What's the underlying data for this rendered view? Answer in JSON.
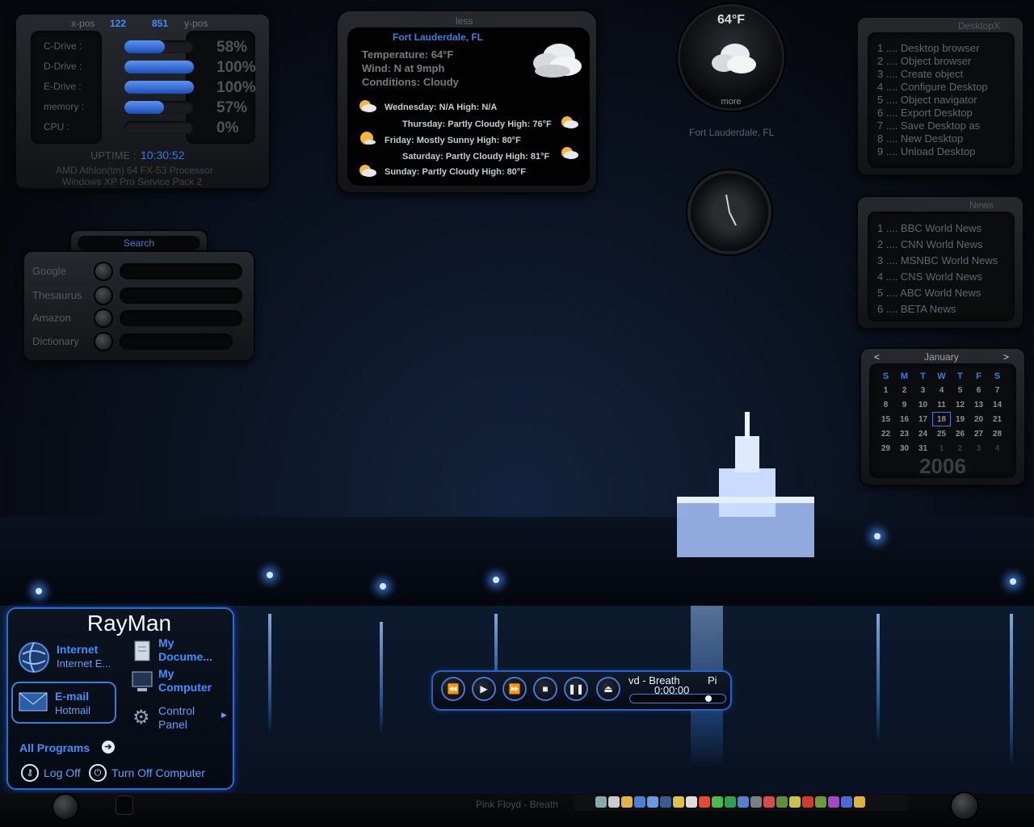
{
  "sysmon": {
    "xpos_label": "x-pos",
    "xpos_value": "122",
    "ypos_value": "851",
    "ypos_label": "y-pos",
    "drives": [
      {
        "label": "C-Drive :",
        "percent": "58%",
        "fill": 0.58
      },
      {
        "label": "D-Drive :",
        "percent": "100%",
        "fill": 1.0
      },
      {
        "label": "E-Drive :",
        "percent": "100%",
        "fill": 1.0
      },
      {
        "label": "memory :",
        "percent": "57%",
        "fill": 0.57
      },
      {
        "label": "CPU :",
        "percent": "0%",
        "fill": 0.0
      }
    ],
    "uptime_label": "UPTIME :",
    "uptime_value": "10:30:52",
    "processor": "AMD Athlon(tm) 64 FX-53 Processor",
    "os": "Windows XP Pro Service Pack 2"
  },
  "weather": {
    "less_label": "less",
    "city": "Fort Lauderdale, FL",
    "temperature": "Temperature: 64°F",
    "wind": "Wind: N at 9mph",
    "conditions": "Conditions: Cloudy",
    "forecast": [
      "Wednesday: N/A High: N/A",
      "Thursday: Partly Cloudy High: 76°F",
      "Friday: Mostly Sunny High: 80°F",
      "Saturday: Partly Cloudy High: 81°F",
      "Sunday: Partly Cloudy High: 80°F"
    ]
  },
  "weather_orb": {
    "temp": "64°F",
    "more_label": "more",
    "city": "Fort Lauderdale, FL"
  },
  "desktopx": {
    "title": "DesktopX",
    "items": [
      "1 .... Desktop browser",
      "2 .... Object browser",
      "3 .... Create object",
      "4 .... Configure Desktop",
      "5 .... Object navigator",
      "6 .... Export Desktop",
      "7 .... Save Desktop as",
      "8 .... New Desktop",
      "9 .... Unload Desktop"
    ]
  },
  "news": {
    "title": "News",
    "items": [
      "1 .... BBC World News",
      "2 .... CNN World News",
      "3 .... MSNBC World News",
      "4 .... CNS World News",
      "5 .... ABC World News",
      "6 .... BETA  News"
    ]
  },
  "search": {
    "title": "Search",
    "engines": [
      "Google",
      "Thesaurus",
      "Amazon",
      "Dictionary"
    ]
  },
  "calendar": {
    "month": "January",
    "prev": "<",
    "next": ">",
    "year": "2006",
    "weekdays": [
      "S",
      "M",
      "T",
      "W",
      "T",
      "F",
      "S"
    ],
    "weeks": [
      [
        "1",
        "2",
        "3",
        "4",
        "5",
        "6",
        "7"
      ],
      [
        "8",
        "9",
        "10",
        "11",
        "12",
        "13",
        "14"
      ],
      [
        "15",
        "16",
        "17",
        "18",
        "19",
        "20",
        "21"
      ],
      [
        "22",
        "23",
        "24",
        "25",
        "26",
        "27",
        "28"
      ],
      [
        "29",
        "30",
        "31",
        "1",
        "2",
        "3",
        "4"
      ]
    ],
    "today": "18"
  },
  "startmenu": {
    "user": "RayMan",
    "internet_title": "Internet",
    "internet_sub": "Internet E...",
    "email_title": "E-mail",
    "email_sub": "Hotmail",
    "mydocs_line1": "My",
    "mydocs_line2": "Docume...",
    "mycomp_line1": "My",
    "mycomp_line2": "Computer",
    "control_line1": "Control",
    "control_line2": "Panel",
    "all_programs": "All Programs",
    "log_off": "Log Off",
    "turn_off": "Turn Off Computer"
  },
  "player": {
    "track": "vd - Breath",
    "track_tail": "Pi",
    "time": "0:00:00",
    "progress": 0.86
  },
  "taskbar": {
    "now_playing": "Pink Floyd - Breath"
  },
  "colors": {
    "accent": "#3f8fff",
    "panel": "#1b1d21"
  }
}
